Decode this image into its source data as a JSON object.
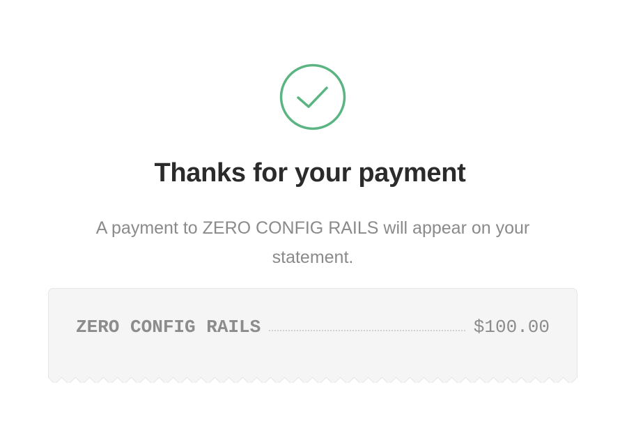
{
  "confirmation": {
    "icon": "check-circle-icon",
    "title": "Thanks for your payment",
    "message": "A payment to ZERO CONFIG RAILS will appear on your statement."
  },
  "receipt": {
    "items": [
      {
        "name": "ZERO CONFIG RAILS",
        "amount": "$100.00"
      }
    ]
  },
  "colors": {
    "success_green": "#5bb583",
    "title_text": "#2b2b2b",
    "body_text": "#8a8a8a",
    "receipt_bg": "#f5f5f5"
  }
}
